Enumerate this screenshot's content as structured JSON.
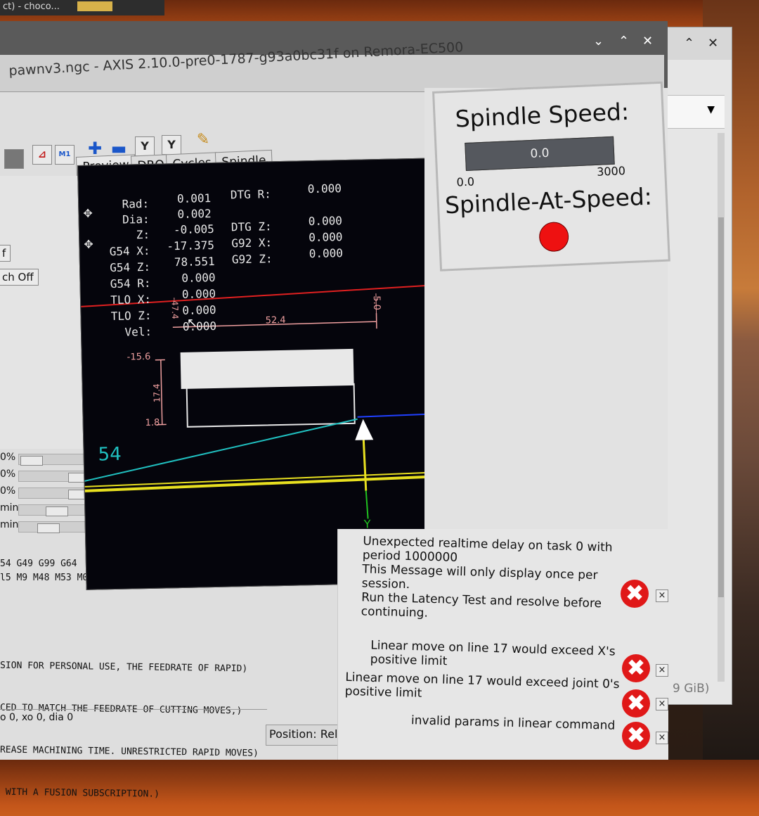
{
  "topbar_text": "ct) - choco...",
  "window": {
    "title": "pawnv3.ngc - AXIS 2.10.0-pre0-1787-g93a0bc31f on Remora-EC500",
    "controls": {
      "minimize": "⌄",
      "maximize": "⌃",
      "close": "✕"
    }
  },
  "bg_window": {
    "controls": {
      "maximize": "⌃",
      "close": "✕"
    },
    "dropdown_arrow": "▼",
    "disk_text": "9 GiB)"
  },
  "toolbar": {
    "icons": [
      "stop-icon",
      "single-step-icon",
      "optional-stop-icon",
      "zoom-in-icon",
      "zoom-out-icon",
      "view-y-icon",
      "view-y2-icon",
      "clear-plot-icon"
    ],
    "y_label": "Y",
    "y2_label": "Y",
    "m1_label": "M1"
  },
  "tabs": [
    "Preview",
    "DRO",
    "Cycles",
    "Spindle"
  ],
  "left_panel": {
    "buttons": [
      "f",
      "ch Off"
    ],
    "sliders": [
      {
        "label": "0%"
      },
      {
        "label": "0%"
      },
      {
        "label": "0%"
      },
      {
        "label": "min"
      },
      {
        "label": "min"
      }
    ],
    "gcodes_line1": "54 G49 G99 G64",
    "gcodes_line2": "l5 M9 M48 M53 M0"
  },
  "dro": {
    "rows_left": [
      {
        "label": "Rad:",
        "value": "0.001"
      },
      {
        "label": "Dia:",
        "value": "0.002"
      },
      {
        "label": "Z:",
        "value": "-0.005"
      },
      {
        "label": "G54 X:",
        "value": "-17.375"
      },
      {
        "label": "G54 Z:",
        "value": "78.551"
      },
      {
        "label": "G54 R:",
        "value": "0.000"
      },
      {
        "label": "TLO X:",
        "value": "0.000"
      },
      {
        "label": "TLO Z:",
        "value": "0.000"
      },
      {
        "label": "Vel:",
        "value": "0.000"
      }
    ],
    "rows_right": [
      {
        "label": "DTG R:",
        "value": "0.000"
      },
      {
        "label": "DTG Z:",
        "value": "0.000"
      },
      {
        "label": "G92 X:",
        "value": "0.000"
      },
      {
        "label": "G92 Z:",
        "value": "0.000"
      }
    ]
  },
  "preview_labels": {
    "dim_x_len": "52.4",
    "dim_z_right": "5.0",
    "dim_left_small": "-47.4",
    "dim_top": "-15.6",
    "dim_height": "17.4",
    "dim_bottom": "1.8",
    "offset_label": "54",
    "axis_y": "Y"
  },
  "spindle": {
    "title": "Spindle Speed:",
    "value": "0.0",
    "min": "0.0",
    "max": "3000",
    "at_speed_label": "Spindle-At-Speed:",
    "led_color": "#ee1111"
  },
  "console": {
    "lines": [
      "SION FOR PERSONAL USE, THE FEEDRATE OF RAPID)",
      "CED TO MATCH THE FEEDRATE OF CUTTING MOVES,)",
      "REASE MACHINING TIME. UNRESTRICTED RAPID MOVES)",
      " WITH A FUSION SUBSCRIPTION.)"
    ],
    "status": "o 0, xo 0, dia 0"
  },
  "position_status": "Position: Relative Actual",
  "messages": [
    {
      "text_lines": [
        "Unexpected realtime delay on task 0 with",
        "period 1000000",
        "This Message will only display once per",
        "session.",
        "Run the Latency Test and resolve before",
        "continuing."
      ]
    },
    {
      "text_lines": [
        "Linear move on line 17 would exceed X's",
        "positive limit"
      ]
    },
    {
      "text_lines": [
        "Linear move on line 17 would exceed joint 0's",
        "positive limit"
      ]
    },
    {
      "text_lines": [
        "invalid params in linear command"
      ]
    }
  ],
  "message_close": "×",
  "error_icon_glyph": "✖"
}
